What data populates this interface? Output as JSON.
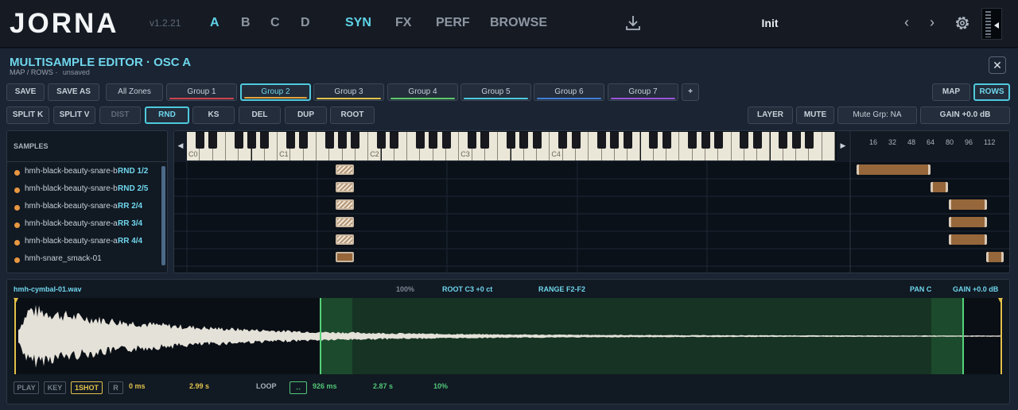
{
  "app": {
    "logo": "JORNA",
    "version": "v1.2.21"
  },
  "osc_tabs": [
    {
      "label": "A",
      "active": true
    },
    {
      "label": "B"
    },
    {
      "label": "C"
    },
    {
      "label": "D"
    }
  ],
  "nav_tabs": [
    {
      "label": "SYN",
      "active": true
    },
    {
      "label": "FX"
    },
    {
      "label": "PERF"
    },
    {
      "label": "BROWSE"
    }
  ],
  "preset": {
    "name": "Init",
    "prev": "‹",
    "next": "›"
  },
  "icons": [
    "download-icon",
    "gear-icon",
    "close-icon",
    "chevron-left-icon",
    "chevron-right-icon",
    "loop-icon"
  ],
  "editor": {
    "title": "MULTISAMPLE EDITOR · OSC A",
    "view": "MAP / ROWS",
    "status": "unsaved",
    "close": "✕"
  },
  "toolbar1": {
    "save": "SAVE",
    "save_as": "SAVE AS",
    "all_zones": "All Zones",
    "add": "+",
    "map": "MAP",
    "rows": "ROWS"
  },
  "groups": [
    {
      "label": "Group 1",
      "color": "#d0454f"
    },
    {
      "label": "Group 2",
      "color": "#e2a23a",
      "active": true
    },
    {
      "label": "Group 3",
      "color": "#e2c14a"
    },
    {
      "label": "Group 4",
      "color": "#5cc96a"
    },
    {
      "label": "Group 5",
      "color": "#4fc9dd"
    },
    {
      "label": "Group 6",
      "color": "#3f7fd8"
    },
    {
      "label": "Group 7",
      "color": "#9a55d8"
    }
  ],
  "toolbar2": {
    "split_k": "SPLIT K",
    "split_v": "SPLIT V",
    "dist": "DIST",
    "rnd": "RND",
    "ks": "KS",
    "del": "DEL",
    "dup": "DUP",
    "root": "ROOT",
    "layer": "LAYER",
    "mute": "MUTE",
    "mute_grp": "Mute Grp: NA",
    "gain": "GAIN +0.0 dB"
  },
  "samples": {
    "header": "SAMPLES",
    "items": [
      {
        "name": "hmh-black-beauty-snare-b",
        "tag": "RND 1/2"
      },
      {
        "name": "hmh-black-beauty-snare-b",
        "tag": "RND 2/5"
      },
      {
        "name": "hmh-black-beauty-snare-a",
        "tag": "RR 2/4"
      },
      {
        "name": "hmh-black-beauty-snare-a",
        "tag": "RR 3/4"
      },
      {
        "name": "hmh-black-beauty-snare-a",
        "tag": "RR 4/4"
      },
      {
        "name": "hmh-snare_smack-01",
        "tag": ""
      }
    ]
  },
  "keyboard": {
    "octave_labels": [
      "C0",
      "C1",
      "C2",
      "C3",
      "C4"
    ],
    "scroll_left": "◀",
    "scroll_right": "▶"
  },
  "velocity": {
    "ticks": [
      "16",
      "32",
      "48",
      "64",
      "80",
      "96",
      "112"
    ]
  },
  "waveform": {
    "file": "hmh-cymbal-01.wav",
    "zoom": "100%",
    "root": "ROOT C3 +0 ct",
    "range": "RANGE F2-F2",
    "pan": "PAN C",
    "gain": "GAIN +0.0 dB",
    "play": "PLAY",
    "key": "KEY",
    "oneshot": "1SHOT",
    "reverse": "R",
    "start": "0 ms",
    "end": "2.99 s",
    "loop_label": "LOOP",
    "loop_toggle": "↔",
    "loop_start": "926 ms",
    "loop_end": "2.87 s",
    "crossfade": "10%"
  }
}
